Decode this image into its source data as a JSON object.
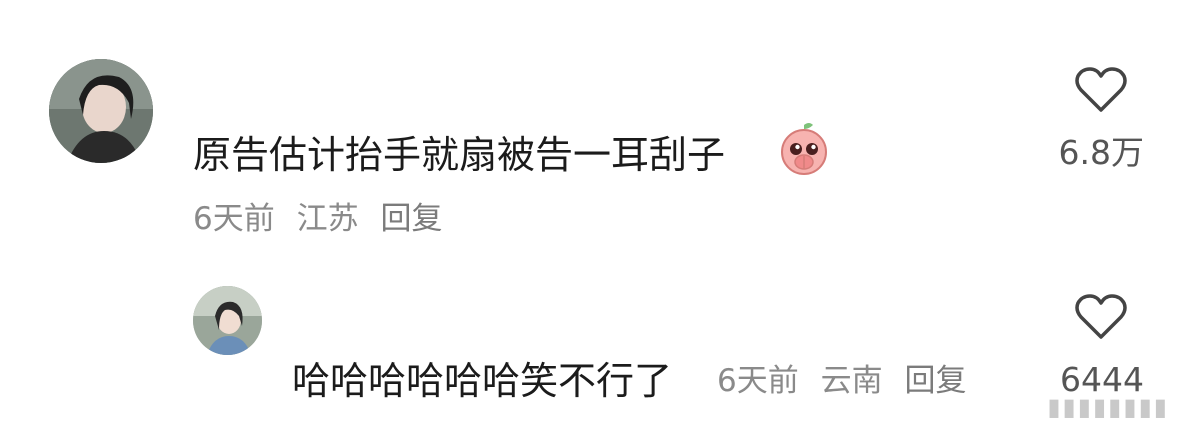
{
  "comments": [
    {
      "text": "原告估计抬手就扇被告一耳刮子",
      "emoji": "pink-peach-pleading-emoji",
      "meta": {
        "time": "6天前",
        "location": "江苏",
        "reply_label": "回复"
      },
      "likes": "6.8万"
    },
    {
      "text": "哈哈哈哈哈哈笑不行了",
      "meta": {
        "time": "6天前",
        "location": "云南",
        "reply_label": "回复"
      },
      "likes": "6444"
    }
  ],
  "watermark": "▮▮▮▮▮▮▮▮",
  "colors": {
    "text": "#1b1b1b",
    "meta": "#8a8a8a",
    "like_icon": "#444444",
    "emoji_pink": "#f5a3a3"
  },
  "icons": [
    "heart-outline-icon"
  ]
}
